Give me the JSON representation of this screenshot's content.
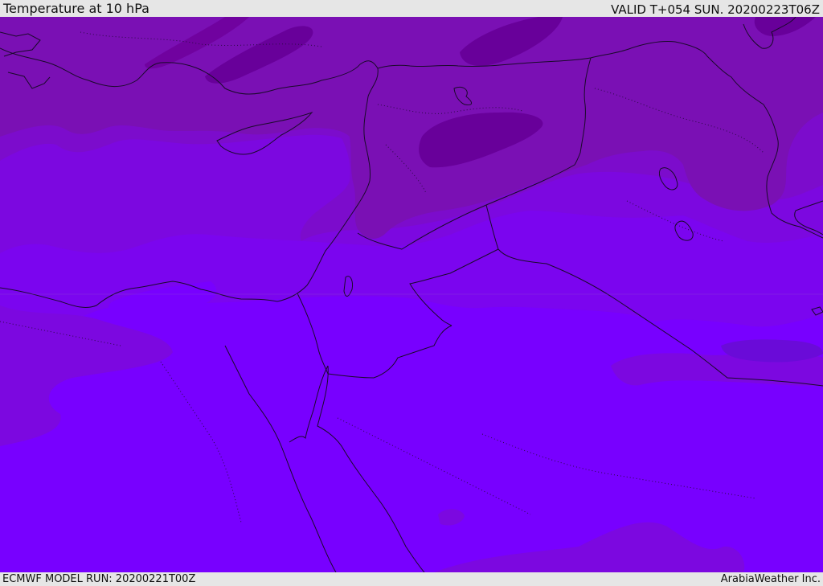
{
  "header": {
    "title": "Temperature at 10 hPa",
    "valid_time": "VALID T+054 SUN. 20200223T06Z"
  },
  "footer": {
    "model_run": "ECMWF MODEL RUN: 20200221T00Z",
    "brand": "ArabiaWeather Inc."
  },
  "map": {
    "variable": "temperature",
    "level": "10 hPa",
    "colors": {
      "warm_band": "#7a10b4",
      "band_2": "#7c0ccc",
      "band_3": "#7c08e0",
      "band_4": "#7b05ef",
      "cold_band": "#7800ff",
      "darkest_band": "#68009a",
      "cold_spot": "#6a0bd8",
      "coastline": "#1a0a2a",
      "border": "#1a0a2a"
    }
  }
}
